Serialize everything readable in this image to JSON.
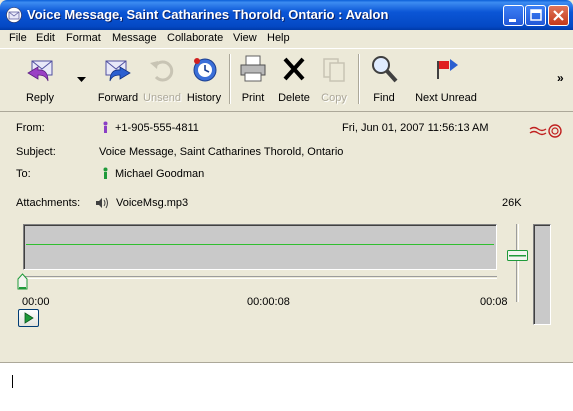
{
  "window": {
    "title": "Voice Message, Saint Catharines Thorold, Ontario :  Avalon",
    "icon": "envelope-app-icon"
  },
  "menu": [
    "File",
    "Edit",
    "Format",
    "Message",
    "Collaborate",
    "View",
    "Help"
  ],
  "toolbar": {
    "reply": "Reply",
    "forward": "Forward",
    "unsend": "Unsend",
    "history": "History",
    "print": "Print",
    "delete": "Delete",
    "copy": "Copy",
    "find": "Find",
    "next_unread": "Next Unread",
    "overflow": "»"
  },
  "message": {
    "from_label": "From:",
    "from_value": "+1-905-555-4811",
    "date": "Fri, Jun 01, 2007 11:56:13 AM",
    "subject_label": "Subject:",
    "subject_value": "Voice Message, Saint Catharines Thorold, Ontario",
    "to_label": "To:",
    "to_value": "Michael Goodman",
    "attachments_label": "Attachments:",
    "attachment_name": "VoiceMsg.mp3",
    "attachment_size": "26K"
  },
  "player": {
    "time_start": "00:00",
    "time_mid": "00:00:08",
    "time_end": "00:08",
    "position_fraction": 0,
    "volume_fraction": 0.65,
    "waveform_color": "#2fbf2f"
  },
  "colors": {
    "title_bar": "#0b56d6",
    "chrome": "#ece9d8"
  }
}
